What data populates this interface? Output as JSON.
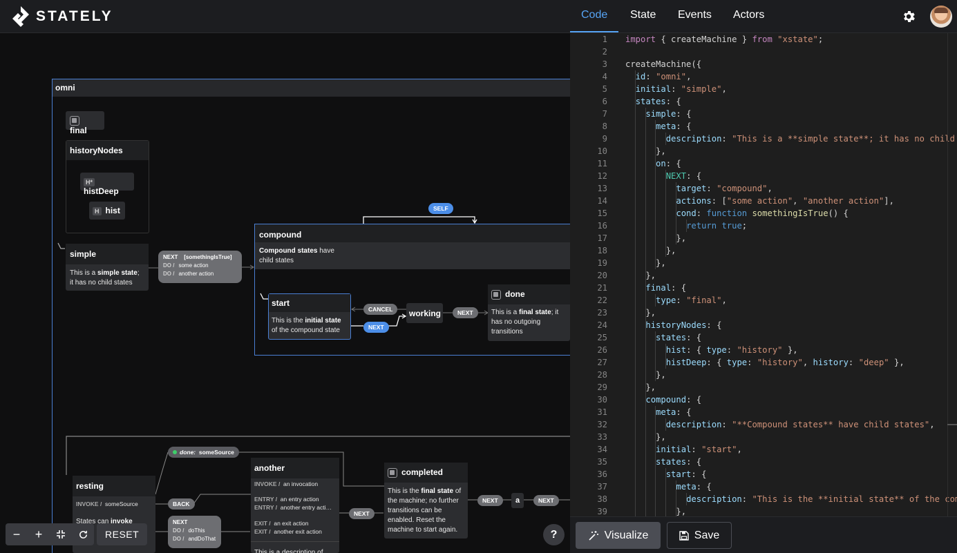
{
  "app": {
    "logo_text": "STATELY"
  },
  "tabs": [
    {
      "label": "Code",
      "active": true
    },
    {
      "label": "State"
    },
    {
      "label": "Events"
    },
    {
      "label": "Actors"
    }
  ],
  "icons": {
    "settings": "gear-icon",
    "avatar": "user-avatar"
  },
  "diagram": {
    "root": "omni",
    "final": "final",
    "historyNodes": {
      "title": "historyNodes",
      "deep": "histDeep",
      "shallow": "hist",
      "deep_badge": "H*",
      "shallow_badge": "H"
    },
    "simple": {
      "title": "simple",
      "desc_pre": "This is a ",
      "desc_bold": "simple state",
      "desc_post": "; it has no child states"
    },
    "next_tx": {
      "event": "NEXT",
      "guard": "[somethingIsTrue]",
      "do1": "some action",
      "do2": "another action",
      "do_label": "DO /"
    },
    "self_pill": "SELF",
    "compound": {
      "title": "compound",
      "desc_bold": "Compound states",
      "desc_post": " have child states"
    },
    "start": {
      "title": "start",
      "desc_pre": "This is the ",
      "desc_bold": "initial state",
      "desc_post": " of the compound state"
    },
    "cancel_pill": "CANCEL",
    "next_pill": "NEXT",
    "working": "working",
    "done": {
      "title": "done",
      "desc_pre": "This is a ",
      "desc_bold": "final state",
      "desc_post": "; it has no outgoing transitions"
    },
    "done_source": {
      "label": "done:",
      "value": "someSource"
    },
    "resting": {
      "title": "resting",
      "invoke_label": "INVOKE /",
      "invoke_value": "someSource",
      "desc_pre": "States can ",
      "desc_bold": "invoke"
    },
    "back_pill": "BACK",
    "next2": {
      "event": "NEXT",
      "do_label": "DO /",
      "do1": "doThis",
      "do2": "andDoThat"
    },
    "another": {
      "title": "another",
      "invoke_label": "INVOKE /",
      "invoke_value": "an invocation",
      "entry_label": "ENTRY /",
      "entry1": "an entry action",
      "entry2": "another entry acti…",
      "exit_label": "EXIT /",
      "exit1": "an exit action",
      "exit2": "another exit action",
      "desc": "This is a description of"
    },
    "next3": "NEXT",
    "completed": {
      "title": "completed",
      "desc_pre": "This is the ",
      "desc_bold": "final state",
      "desc_post": " of the machine; no further transitions can be enabled. Reset the machine to start again."
    },
    "next4": "NEXT",
    "a": "a",
    "next5": "NEXT"
  },
  "toolbar": {
    "zoom_out": "−",
    "zoom_in": "+",
    "fit": "fit-icon",
    "reset_icon": "refresh-icon",
    "reset_label": "RESET",
    "help": "?"
  },
  "code_lines": [
    "import { createMachine } from \"xstate\";",
    "",
    "createMachine({",
    "  id: \"omni\",",
    "  initial: \"simple\",",
    "  states: {",
    "    simple: {",
    "      meta: {",
    "        description: \"This is a **simple state**; it has no child s",
    "      },",
    "      on: {",
    "        NEXT: {",
    "          target: \"compound\",",
    "          actions: [\"some action\", \"another action\"],",
    "          cond: function somethingIsTrue() {",
    "            return true;",
    "          },",
    "        },",
    "      },",
    "    },",
    "    final: {",
    "      type: \"final\",",
    "    },",
    "    historyNodes: {",
    "      states: {",
    "        hist: { type: \"history\" },",
    "        histDeep: { type: \"history\", history: \"deep\" },",
    "      },",
    "    },",
    "    compound: {",
    "      meta: {",
    "        description: \"**Compound states** have child states\",",
    "      },",
    "      initial: \"start\",",
    "      states: {",
    "        start: {",
    "          meta: {",
    "            description: \"This is the **initial state** of the comp",
    "          },"
  ],
  "buttons": {
    "visualize": "Visualize",
    "save": "Save"
  }
}
